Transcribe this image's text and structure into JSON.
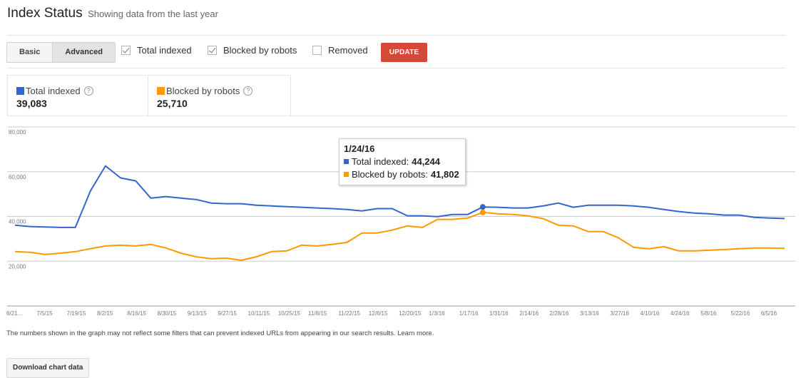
{
  "header": {
    "title": "Index Status",
    "subtitle": "Showing data from the last year"
  },
  "controls": {
    "view_toggle": [
      {
        "label": "Basic",
        "active": false
      },
      {
        "label": "Advanced",
        "active": true
      }
    ],
    "checkboxes": [
      {
        "label": "Total indexed",
        "checked": true
      },
      {
        "label": "Blocked by robots",
        "checked": true
      },
      {
        "label": "Removed",
        "checked": false
      }
    ],
    "update_label": "UPDATE"
  },
  "summary": [
    {
      "label": "Total indexed",
      "value": "39,083",
      "color": "#3366cc",
      "icon": "help-icon"
    },
    {
      "label": "Blocked by robots",
      "value": "25,710",
      "color": "#ff9900",
      "icon": "help-icon"
    }
  ],
  "tooltip": {
    "date": "1/24/16",
    "rows": [
      {
        "label": "Total indexed:",
        "value": "44,244",
        "color": "#3366cc"
      },
      {
        "label": "Blocked by robots:",
        "value": "41,802",
        "color": "#ff9900"
      }
    ]
  },
  "footer": {
    "note": "The numbers shown in the graph may not reflect some filters that can prevent indexed URLs from appearing in our search results.",
    "learn_more": "Learn more.",
    "download_label": "Download chart data"
  },
  "colors": {
    "accent": "#d64937",
    "total_indexed": "#3366cc",
    "blocked_by_robots": "#ff9900",
    "grid": "#cccccc"
  },
  "chart_data": {
    "type": "line",
    "title": "",
    "xlabel": "",
    "ylabel": "",
    "ylim": [
      0,
      80000
    ],
    "yticks": [
      20000,
      40000,
      60000,
      80000
    ],
    "ytick_labels": [
      "20,000",
      "40,000",
      "60,000",
      "80,000"
    ],
    "grid": true,
    "legend": "none",
    "x_tick_labels": [
      "6/21...",
      "7/5/15",
      "7/19/15",
      "8/2/15",
      "8/16/15",
      "8/30/15",
      "9/13/15",
      "9/27/15",
      "10/11/15",
      "10/25/15",
      "11/8/15",
      "11/22/15",
      "12/6/15",
      "12/20/15",
      "1/3/16",
      "1/17/16",
      "1/31/16",
      "2/14/16",
      "2/28/16",
      "3/13/16",
      "3/27/16",
      "4/10/16",
      "4/24/16",
      "5/8/16",
      "5/22/16",
      "6/5/16"
    ],
    "x_point_count": 52,
    "x_interval": "weekly",
    "highlighted_index": 31,
    "series": [
      {
        "name": "Total indexed",
        "color": "#3366cc",
        "values": [
          36100,
          35500,
          35300,
          35100,
          35100,
          51400,
          62600,
          57200,
          55900,
          48200,
          48900,
          48200,
          47600,
          46000,
          45700,
          45700,
          45000,
          44700,
          44400,
          44100,
          43800,
          43500,
          43100,
          42500,
          43500,
          43500,
          40300,
          40300,
          39900,
          40900,
          40900,
          44244,
          44100,
          43800,
          43800,
          44700,
          46000,
          44100,
          45000,
          45000,
          45000,
          44700,
          44100,
          43100,
          42200,
          41500,
          41200,
          40600,
          40600,
          39600,
          39300,
          39083
        ]
      },
      {
        "name": "Blocked by robots",
        "color": "#ff9900",
        "values": [
          24300,
          24000,
          23000,
          23600,
          24300,
          25600,
          26800,
          27200,
          26800,
          27500,
          25900,
          23600,
          22000,
          21100,
          21400,
          20400,
          22000,
          24300,
          24600,
          27200,
          26800,
          27500,
          28400,
          32600,
          32600,
          33900,
          35800,
          35100,
          38700,
          38700,
          39300,
          41802,
          41200,
          40900,
          40300,
          39000,
          36100,
          35800,
          33200,
          33200,
          30400,
          26200,
          25600,
          26500,
          24600,
          24600,
          24900,
          25200,
          25600,
          25900,
          25900,
          25710
        ]
      }
    ]
  }
}
